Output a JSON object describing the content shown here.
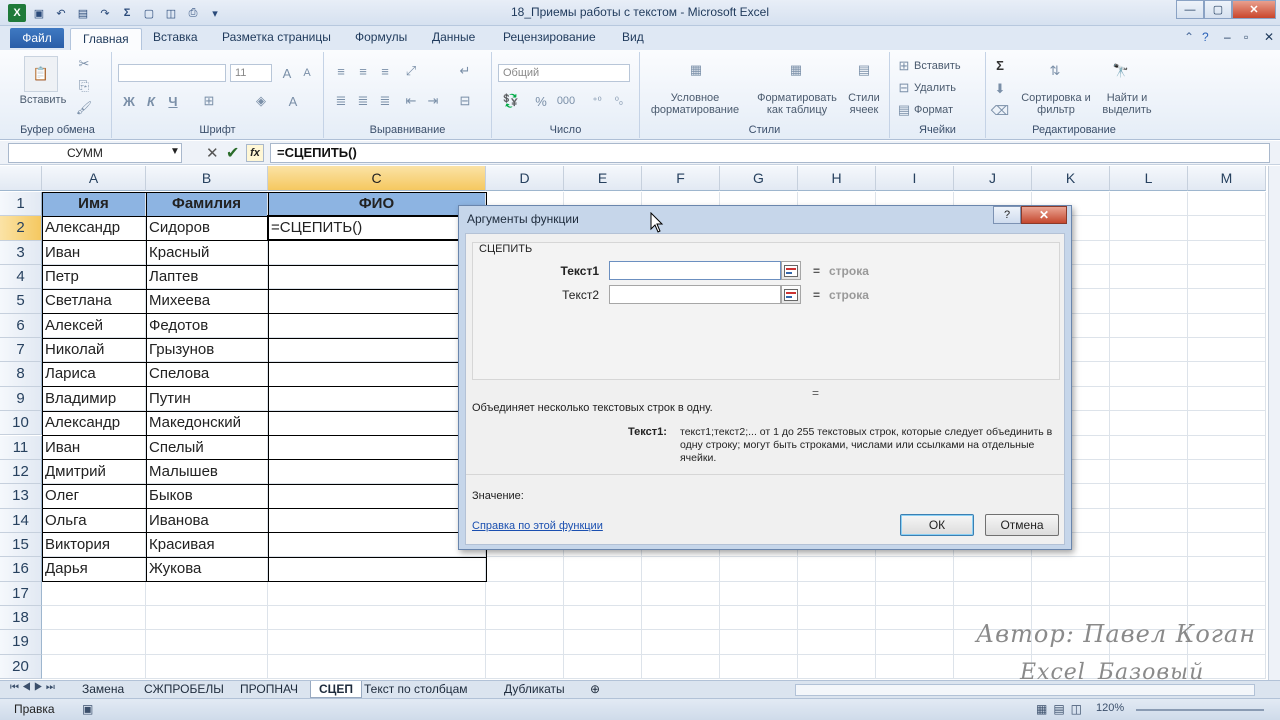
{
  "window": {
    "title": "18_Приемы работы с текстом  -  Microsoft Excel"
  },
  "tabs": [
    "Файл",
    "Главная",
    "Вставка",
    "Разметка страницы",
    "Формулы",
    "Данные",
    "Рецензирование",
    "Вид"
  ],
  "ribbon": {
    "clipboard": {
      "paste": "Вставить",
      "group": "Буфер обмена"
    },
    "font": {
      "size": "11",
      "group": "Шрифт",
      "bold": "Ж",
      "italic": "К",
      "underline": "Ч"
    },
    "alignment": {
      "group": "Выравнивание"
    },
    "number": {
      "format": "Общий",
      "group": "Число",
      "percent": "%",
      "thousands": "000"
    },
    "styles": {
      "cond": "Условное форматирование",
      "table": "Форматировать как таблицу",
      "cell": "Стили ячеек",
      "group": "Стили"
    },
    "cells": {
      "insert": "Вставить",
      "delete": "Удалить",
      "format": "Формат",
      "group": "Ячейки"
    },
    "editing": {
      "sort": "Сортировка и фильтр",
      "find": "Найти и выделить",
      "group": "Редактирование"
    }
  },
  "formula_bar": {
    "name_box": "СУММ",
    "formula": "=СЦЕПИТЬ()"
  },
  "columns": [
    "A",
    "B",
    "C",
    "D",
    "E",
    "F",
    "G",
    "H",
    "I",
    "J",
    "K",
    "L",
    "M"
  ],
  "rows": [
    "1",
    "2",
    "3",
    "4",
    "5",
    "6",
    "7",
    "8",
    "9",
    "10",
    "11",
    "12",
    "13",
    "14",
    "15",
    "16",
    "17",
    "18",
    "19",
    "20"
  ],
  "headers": {
    "a": "Имя",
    "b": "Фамилия",
    "c": "ФИО"
  },
  "data": [
    {
      "a": "Александр",
      "b": "Сидоров",
      "c": "=СЦЕПИТЬ()"
    },
    {
      "a": "Иван",
      "b": "Красный",
      "c": ""
    },
    {
      "a": "Петр",
      "b": "Лаптев",
      "c": ""
    },
    {
      "a": "Светлана",
      "b": "Михеева",
      "c": ""
    },
    {
      "a": "Алексей",
      "b": "Федотов",
      "c": ""
    },
    {
      "a": "Николай",
      "b": "Грызунов",
      "c": ""
    },
    {
      "a": "Лариса",
      "b": "Спелова",
      "c": ""
    },
    {
      "a": "Владимир",
      "b": "Путин",
      "c": ""
    },
    {
      "a": "Александр",
      "b": "Македонский",
      "c": ""
    },
    {
      "a": "Иван",
      "b": "Спелый",
      "c": ""
    },
    {
      "a": "Дмитрий",
      "b": "Малышев",
      "c": ""
    },
    {
      "a": "Олег",
      "b": "Быков",
      "c": ""
    },
    {
      "a": "Ольга",
      "b": "Иванова",
      "c": ""
    },
    {
      "a": "Виктория",
      "b": "Красивая",
      "c": ""
    },
    {
      "a": "Дарья",
      "b": "Жукова",
      "c": ""
    }
  ],
  "dialog": {
    "title": "Аргументы функции",
    "function": "СЦЕПИТЬ",
    "arg1_label": "Текст1",
    "arg2_label": "Текст2",
    "eq": "=",
    "arg_result": "строка",
    "result_eq": "=",
    "description": "Объединяет несколько текстовых строк в одну.",
    "arg_desc_label": "Текст1:",
    "arg_desc": "текст1;текст2;... от 1 до 255 текстовых строк, которые следует объединить в одну строку; могут быть строками, числами или ссылками на отдельные ячейки.",
    "value_label": "Значение:",
    "help_link": "Справка по этой функции",
    "ok": "ОК",
    "cancel": "Отмена"
  },
  "sheets": [
    "Замена",
    "СЖПРОБЕЛЫ",
    "ПРОПНАЧ",
    "СЦЕП",
    "Текст по столбцам",
    "Дубликаты"
  ],
  "active_sheet": "СЦЕП",
  "status": {
    "mode": "Правка",
    "zoom": "120%"
  },
  "watermark": {
    "line1": "Автор: Павел Коган",
    "line2": "Excel_Базовый"
  }
}
